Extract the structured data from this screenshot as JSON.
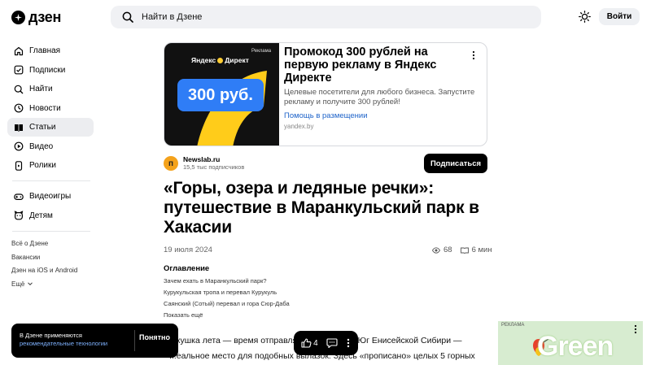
{
  "header": {
    "logo_text": "дзен",
    "search_placeholder": "Найти в Дзене",
    "login_label": "Войти"
  },
  "sidebar": {
    "items": [
      {
        "label": "Главная",
        "icon": "home-icon"
      },
      {
        "label": "Подписки",
        "icon": "subscriptions-icon"
      },
      {
        "label": "Найти",
        "icon": "search-icon"
      },
      {
        "label": "Новости",
        "icon": "news-icon"
      },
      {
        "label": "Статьи",
        "icon": "articles-icon",
        "active": true
      },
      {
        "label": "Видео",
        "icon": "video-icon"
      },
      {
        "label": "Ролики",
        "icon": "shorts-icon"
      }
    ],
    "items2": [
      {
        "label": "Видеоигры",
        "icon": "gamepad-icon"
      },
      {
        "label": "Детям",
        "icon": "kids-icon"
      }
    ],
    "footer": [
      "Всё о Дзене",
      "Вакансии",
      "Дзен на iOS и Android",
      "Ещё"
    ]
  },
  "ad": {
    "label": "Реклама",
    "brand": "Яндекс Директ",
    "price": "300 руб.",
    "title": "Промокод 300 рублей на первую рекламу в Яндекс Директе",
    "description": "Целевые посетители для любого бизнеса. Запустите рекламу и получите 300 рублей!",
    "link": "Помощь в размещении",
    "domain": "yandex.by"
  },
  "channel": {
    "avatar_letter": "п",
    "name": "Newslab.ru",
    "subscribers": "15,5 тыс подписчиков",
    "subscribe_label": "Подписаться"
  },
  "article": {
    "title": "«Горы, озера и ледяные речки»: путешествие в Маранкульский парк в Хакасии",
    "date": "19 июля 2024",
    "views": "68",
    "read_time": "6 мин",
    "toc_heading": "Оглавление",
    "toc": [
      "Зачем ехать в Маранкульский парк?",
      "Курукульская тропа и перевал Курукуль",
      "Саянский (Сотый) перевал и гора Сюр-Даба"
    ],
    "toc_more": "Показать ещё",
    "body": "...кушка лета — время отправляться в походы. Юг Енисейской Сибири — ...еальное место для подобных вылазок. Здесь «прописано» целых 5 горных"
  },
  "cookie": {
    "text": "В Дзене применяются",
    "link": "рекомендательные технологии",
    "button": "Понятно"
  },
  "floatbar": {
    "likes": "4"
  },
  "right_ad": {
    "label": "РЕКЛАМА",
    "text": "Green"
  }
}
